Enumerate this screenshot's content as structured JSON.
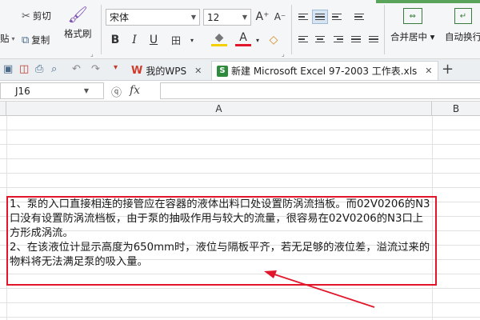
{
  "ribbon": {
    "paste_label": "贴",
    "cut_label": "剪切",
    "copy_label": "复制",
    "format_painter_label": "格式刷",
    "font_name": "宋体",
    "font_size": "12",
    "grow_font": "A⁺",
    "shrink_font": "A⁻",
    "bold": "B",
    "italic": "I",
    "underline": "U",
    "border": "田",
    "fill": "◆",
    "font_color": "A",
    "clear": "◇",
    "merge_center_label": "合并居中 ▾",
    "auto_wrap_label": "自动换行",
    "accent_red": "#e2162a",
    "accent_green": "#2e8b3e"
  },
  "tabs": [
    {
      "label": "我的WPS",
      "close": "✕"
    },
    {
      "label": "新建 Microsoft Excel 97-2003 工作表.xls",
      "close": "✕"
    }
  ],
  "new_tab": "+",
  "formula_bar": {
    "cell_ref": "J16",
    "fx_label": "fx",
    "value": ""
  },
  "columns": [
    "A",
    "B"
  ],
  "cell_content": "1、泵的入口直接相连的接管应在容器的液体出料口处设置防涡流挡板。而02V0206的N3口没有设置防涡流档板，由于泵的抽吸作用与较大的流量，很容易在02V0206的N3口上方形成涡流。\n2、在该液位计显示高度为650mm时，液位与隔板平齐，若无足够的液位差，溢流过来的物料将无法满足泵的吸入量。"
}
